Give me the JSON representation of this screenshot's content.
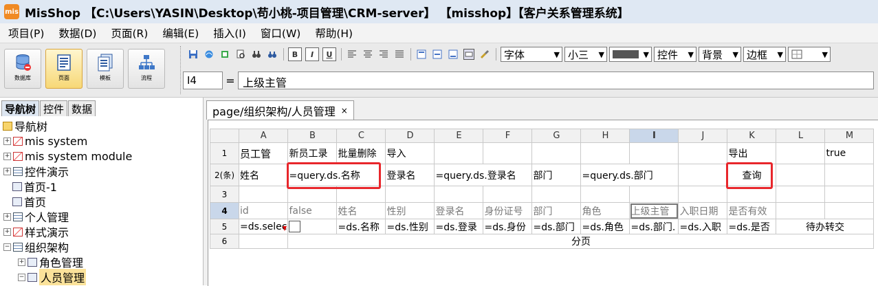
{
  "window": {
    "title": "MisShop 【C:\\Users\\YASIN\\Desktop\\苟小桃-项目管理\\CRM-server】 【misshop】【客户关系管理系统】",
    "logo_text": "mis"
  },
  "menu": [
    "项目(P)",
    "数据(D)",
    "页面(R)",
    "编辑(E)",
    "插入(I)",
    "窗口(W)",
    "帮助(H)"
  ],
  "modes": [
    {
      "label": "数据库",
      "active": false,
      "icon": "database-icon"
    },
    {
      "label": "页面",
      "active": true,
      "icon": "page-icon"
    },
    {
      "label": "模板",
      "active": false,
      "icon": "template-icon"
    },
    {
      "label": "流程",
      "active": false,
      "icon": "flow-icon"
    }
  ],
  "format": {
    "font_label": "字体",
    "size_label": "小三",
    "control_label": "控件",
    "background_label": "背景",
    "border_label": "边框"
  },
  "formula": {
    "cell_ref": "I4",
    "equals": "=",
    "value": "上级主管"
  },
  "left_tabs": [
    "导航树",
    "控件",
    "数据"
  ],
  "tree": [
    {
      "label": "导航树",
      "level": 0,
      "icon": "folder-icon",
      "exp": ""
    },
    {
      "label": "mis system",
      "level": 1,
      "icon": "red",
      "exp": "+"
    },
    {
      "label": "mis system module",
      "level": 1,
      "icon": "red",
      "exp": "+"
    },
    {
      "label": "控件演示",
      "level": 1,
      "icon": "grid",
      "exp": "+"
    },
    {
      "label": "首页-1",
      "level": 1,
      "icon": "page",
      "exp": ""
    },
    {
      "label": "首页",
      "level": 1,
      "icon": "page",
      "exp": ""
    },
    {
      "label": "个人管理",
      "level": 1,
      "icon": "grid",
      "exp": "+"
    },
    {
      "label": "样式演示",
      "level": 1,
      "icon": "red",
      "exp": "+"
    },
    {
      "label": "组织架构",
      "level": 1,
      "icon": "grid",
      "exp": "-"
    },
    {
      "label": "角色管理",
      "level": 2,
      "icon": "page",
      "exp": "+"
    },
    {
      "label": "人员管理",
      "level": 2,
      "icon": "page",
      "exp": "-",
      "selected": true
    }
  ],
  "doc_tab": {
    "label": "page/组织架构/人员管理",
    "close": "×"
  },
  "sheet": {
    "columns": [
      "A",
      "B",
      "C",
      "D",
      "E",
      "F",
      "G",
      "H",
      "I",
      "J",
      "K",
      "L",
      "M"
    ],
    "row_labels": [
      "1",
      "2(条)",
      "3",
      "4",
      "5",
      "6"
    ],
    "row1": {
      "A": "员工管",
      "B": "新员工录",
      "C": "批量删除",
      "D": "导入",
      "K": "导出",
      "M": "true"
    },
    "row2": {
      "A": "姓名",
      "B": "=query.ds.名称",
      "D": "登录名",
      "E": "=query.ds.登录名",
      "G": "部门",
      "H": "=query.ds.部门",
      "K": "查询"
    },
    "row4": {
      "A": "id",
      "B": "false",
      "C": "姓名",
      "D": "性别",
      "E": "登录名",
      "F": "身份证号",
      "G": "部门",
      "H": "角色",
      "I": "上级主管",
      "J": "入职日期",
      "K": "是否有效"
    },
    "row5": {
      "A": "=ds.selec",
      "C": "=ds.名称",
      "D": "=ds.性别",
      "E": "=ds.登录",
      "F": "=ds.身份",
      "G": "=ds.部门",
      "H": "=ds.角色",
      "I": "=ds.部门.",
      "J": "=ds.入职",
      "K": "=ds.是否",
      "LM": "待办转交"
    },
    "row6": {
      "merged": "分页"
    }
  }
}
